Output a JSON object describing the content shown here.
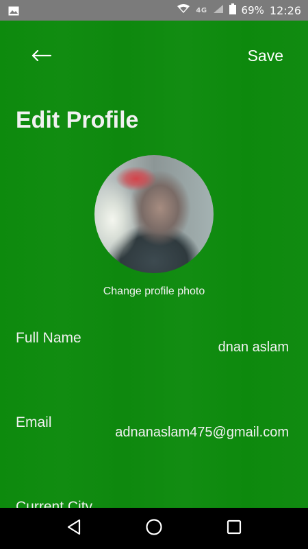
{
  "status_bar": {
    "network_type": "4G",
    "battery": "69%",
    "time": "12:26"
  },
  "header": {
    "back_icon": "arrow-left-icon",
    "save_label": "Save"
  },
  "title": "Edit Profile",
  "profile": {
    "change_photo_label": "Change profile photo"
  },
  "fields": {
    "full_name": {
      "label": "Full Name",
      "value": "dnan aslam"
    },
    "email": {
      "label": "Email",
      "value": "adnanaslam475@gmail.com"
    },
    "current_city": {
      "label": "Current City"
    }
  },
  "nav": {
    "back_icon": "triangle-back-icon",
    "home_icon": "circle-home-icon",
    "recents_icon": "square-recents-icon"
  }
}
